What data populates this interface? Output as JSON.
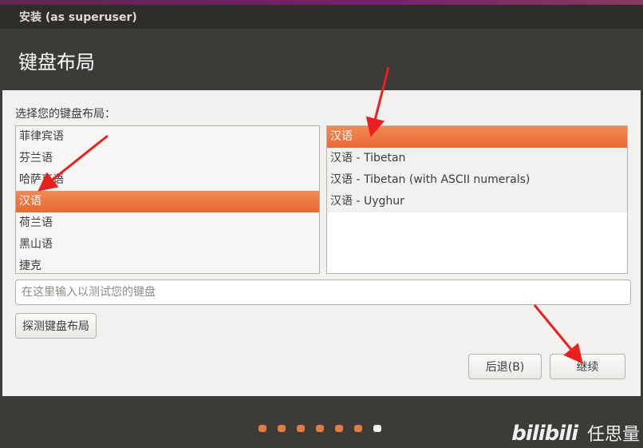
{
  "window": {
    "title": "安装 (as superuser)"
  },
  "page": {
    "heading": "键盘布局",
    "prompt": "选择您的键盘布局："
  },
  "layouts": {
    "items": [
      {
        "label": "菲律宾语",
        "selected": false
      },
      {
        "label": "芬兰语",
        "selected": false
      },
      {
        "label": "哈萨克语",
        "selected": false
      },
      {
        "label": "汉语",
        "selected": true
      },
      {
        "label": "荷兰语",
        "selected": false
      },
      {
        "label": "黑山语",
        "selected": false
      },
      {
        "label": "捷克",
        "selected": false
      }
    ]
  },
  "variants": {
    "items": [
      {
        "label": "汉语",
        "selected": true
      },
      {
        "label": "汉语 - Tibetan",
        "selected": false
      },
      {
        "label": "汉语 - Tibetan (with ASCII numerals)",
        "selected": false
      },
      {
        "label": "汉语 - Uyghur",
        "selected": false
      }
    ]
  },
  "test_input": {
    "value": "",
    "placeholder": "在这里输入以测试您的键盘"
  },
  "buttons": {
    "detect": "探测键盘布局",
    "back": "后退(B)",
    "continue": "继续"
  },
  "progress": {
    "total_steps": 7,
    "current_step": 7
  },
  "watermark": {
    "logo": "bilibili",
    "uploader": "任思量"
  },
  "colors": {
    "accent": "#e76a33",
    "dark_bg": "#3c3b37",
    "panel_bg": "#f2f1f0"
  }
}
